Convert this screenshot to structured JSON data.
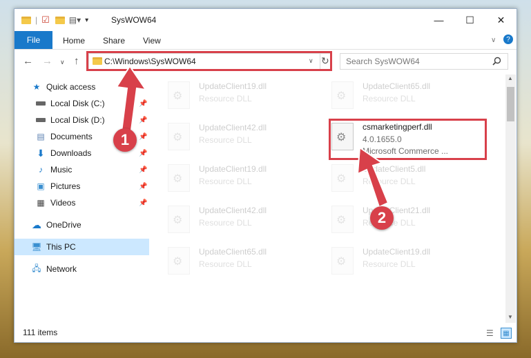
{
  "window": {
    "title": "SysWOW64",
    "minimize": "—",
    "maximize": "☐",
    "close": "✕"
  },
  "ribbon": {
    "file": "File",
    "home": "Home",
    "share": "Share",
    "view": "View",
    "expand": "∨",
    "help": "?"
  },
  "address": {
    "path": "C:\\Windows\\SysWOW64",
    "back": "←",
    "forward": "→",
    "recent": "∨",
    "up": "↑",
    "dropdown": "∨",
    "refresh": "↻"
  },
  "search": {
    "placeholder": "Search SysWOW64"
  },
  "sidebar": {
    "quick_access": "Quick access",
    "items": [
      {
        "label": "Local Disk (C:)",
        "icon": "drive-icon"
      },
      {
        "label": "Local Disk (D:)",
        "icon": "drive-icon"
      },
      {
        "label": "Documents",
        "icon": "documents-icon"
      },
      {
        "label": "Downloads",
        "icon": "downloads-icon"
      },
      {
        "label": "Music",
        "icon": "music-icon"
      },
      {
        "label": "Pictures",
        "icon": "pictures-icon"
      },
      {
        "label": "Videos",
        "icon": "videos-icon"
      }
    ],
    "onedrive": "OneDrive",
    "this_pc": "This PC",
    "network": "Network"
  },
  "files": [
    {
      "name": "UpdateClient19.dll",
      "type": "Resource DLL"
    },
    {
      "name": "UpdateClient65.dll",
      "type": "Resource DLL"
    },
    {
      "name": "UpdateClient42.dll",
      "type": "Resource DLL"
    },
    {
      "name": "csmarketingperf.dll",
      "version": "4.0.1655.0",
      "desc": "Microsoft Commerce ..."
    },
    {
      "name": "UpdateClient19.dll",
      "type": "Resource DLL"
    },
    {
      "name": "UpdateClient5.dll",
      "type": "Resource DLL"
    },
    {
      "name": "UpdateClient42.dll",
      "type": "Resource DLL"
    },
    {
      "name": "UpdateClient21.dll",
      "type": "Resource DLL"
    },
    {
      "name": "UpdateClient65.dll",
      "type": "Resource DLL"
    },
    {
      "name": "UpdateClient19.dll",
      "type": "Resource DLL"
    }
  ],
  "status": {
    "item_count": "111 items"
  },
  "markers": {
    "one": "1",
    "two": "2"
  },
  "colors": {
    "accent": "#1979ca",
    "highlight": "#d8404a",
    "selection": "#cce8ff"
  }
}
